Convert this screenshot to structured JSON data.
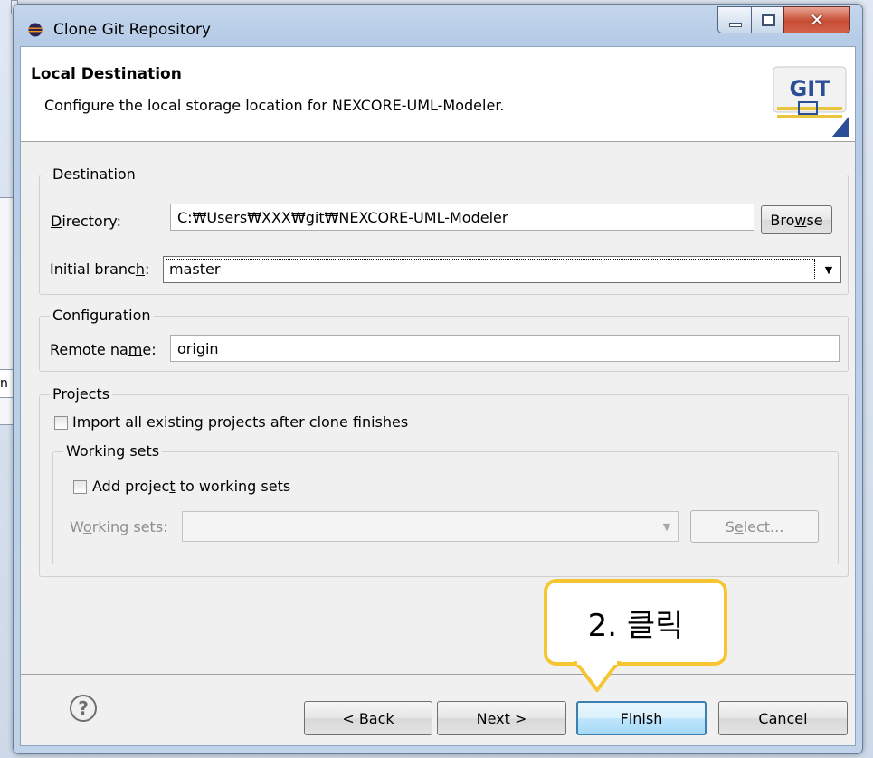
{
  "window": {
    "title": "Clone Git Repository"
  },
  "header": {
    "title": "Local Destination",
    "description": "Configure the local storage location for NEXCORE-UML-Modeler."
  },
  "background_tab": {
    "label": "n"
  },
  "destination": {
    "group_label": "Destination",
    "directory_label_prefix": "D",
    "directory_label_rest": "irectory:",
    "directory_value": "C:₩Users₩XXX₩git₩NEXCORE-UML-Modeler",
    "browse_prefix": "Bro",
    "browse_accel": "w",
    "browse_rest": "se",
    "branch_label_prefix": "Initial branc",
    "branch_label_accel": "h",
    "branch_label_rest": ":",
    "branch_value": "master"
  },
  "configuration": {
    "group_label": "Configuration",
    "remote_label_prefix": "Remote na",
    "remote_label_accel": "m",
    "remote_label_rest": "e:",
    "remote_value": "origin"
  },
  "projects": {
    "group_label": "Projects",
    "import_label": "Import all existing projects after clone finishes",
    "working_sets": {
      "group_label": "Working sets",
      "add_label_prefix": "Add projec",
      "add_label_accel": "t",
      "add_label_rest": " to working sets",
      "sets_label_prefix": "W",
      "sets_label_accel": "o",
      "sets_label_rest": "rking sets:",
      "sets_value": "",
      "select_label_prefix": "S",
      "select_label_accel": "e",
      "select_label_rest": "lect..."
    }
  },
  "footer": {
    "back_prefix": "< ",
    "back_accel": "B",
    "back_rest": "ack",
    "next_accel": "N",
    "next_rest": "ext >",
    "finish_accel": "F",
    "finish_rest": "inish",
    "cancel_label": "Cancel"
  },
  "annotation": {
    "text": "2. 클릭"
  },
  "colors": {
    "callout_border": "#f6c632",
    "default_button_border": "#3c7fb1",
    "close_button": "#c74d34"
  }
}
